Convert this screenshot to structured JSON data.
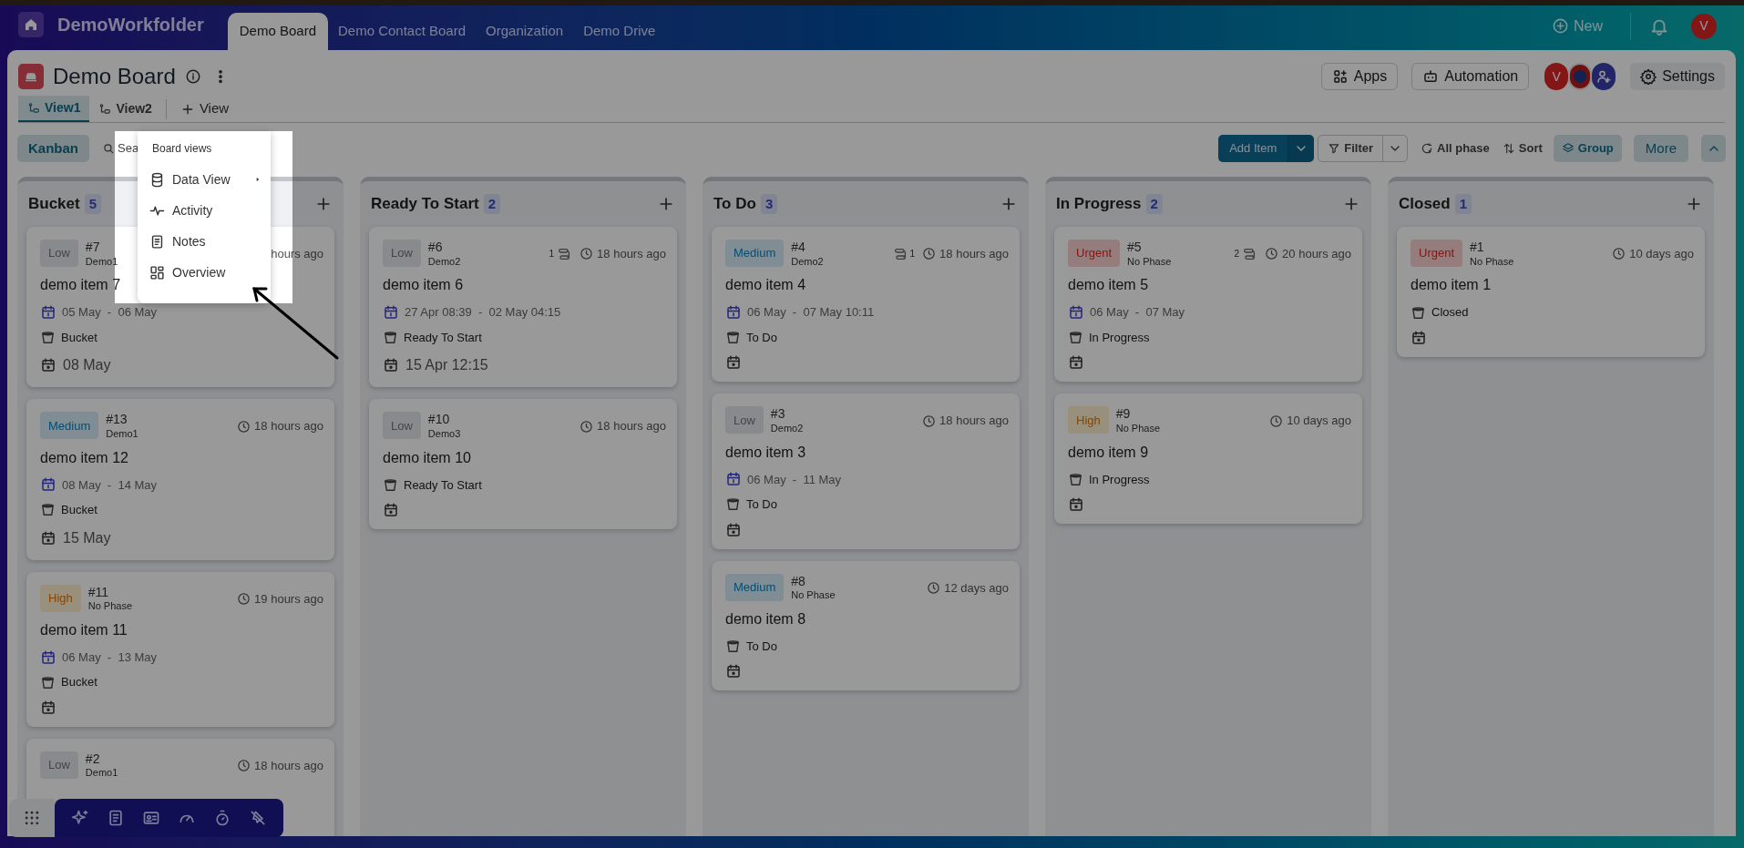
{
  "app": {
    "name": "DemoWorkfolder"
  },
  "nav_tabs": [
    {
      "label": "Demo Board",
      "selected": true
    },
    {
      "label": "Demo Contact Board",
      "selected": false
    },
    {
      "label": "Organization",
      "selected": false
    },
    {
      "label": "Demo Drive",
      "selected": false
    }
  ],
  "header_actions": {
    "new_label": "New",
    "avatar": "V"
  },
  "board": {
    "title": "Demo Board",
    "apps": "Apps",
    "automation": "Automation",
    "members": [
      {
        "kind": "letter",
        "initial": "V"
      },
      {
        "kind": "image"
      },
      {
        "kind": "add"
      }
    ],
    "settings": "Settings"
  },
  "views": [
    {
      "label": "View1",
      "selected": true
    },
    {
      "label": "View2",
      "selected": false
    }
  ],
  "add_view": "View",
  "toolbar": {
    "layout": "Kanban",
    "search": "Sea",
    "add_item": "Add Item",
    "filter": "Filter",
    "phase": "All phase",
    "sort": "Sort",
    "group": "Group",
    "more": "More"
  },
  "columns": [
    {
      "title": "Bucket",
      "count": "5",
      "cards": [
        {
          "priority": "Low",
          "kind": "low",
          "number": "#7",
          "group": "Demo1",
          "time": "hours ago",
          "title": "demo item 7",
          "dates": "05 May  -  06 May",
          "phase": "Bucket",
          "due": "08 May"
        },
        {
          "priority": "Medium",
          "kind": "medium",
          "number": "#13",
          "group": "Demo1",
          "time": "18 hours ago",
          "title": "demo item 12",
          "dates": "08 May  -  14 May",
          "phase": "Bucket",
          "due": "15 May"
        },
        {
          "priority": "High",
          "kind": "high",
          "number": "#11",
          "group": "No Phase",
          "time": "19 hours ago",
          "title": "demo item 11",
          "dates": "06 May  -  13 May",
          "phase": "Bucket"
        },
        {
          "priority": "Low",
          "kind": "low",
          "number": "#2",
          "group": "Demo1",
          "time": "18 hours ago"
        }
      ]
    },
    {
      "title": "Ready To Start",
      "count": "2",
      "cards": [
        {
          "priority": "Low",
          "kind": "low",
          "number": "#6",
          "group": "Demo2",
          "subitems": {
            "count": "1",
            "kind": "count_first"
          },
          "time": "18 hours ago",
          "title": "demo item 6",
          "dates": "27 Apr 08:39  -  02 May 04:15",
          "phase": "Ready To Start",
          "due": "15 Apr 12:15"
        },
        {
          "priority": "Low",
          "kind": "low",
          "number": "#10",
          "group": "Demo3",
          "time": "18 hours ago",
          "title": "demo item 10",
          "phase": "Ready To Start"
        }
      ]
    },
    {
      "title": "To Do",
      "count": "3",
      "cards": [
        {
          "priority": "Medium",
          "kind": "medium",
          "number": "#4",
          "group": "Demo2",
          "subitems": {
            "count": "1",
            "kind": "icon_first"
          },
          "time": "18 hours ago",
          "title": "demo item 4",
          "dates": "06 May  -  07 May 10:11",
          "phase": "To Do"
        },
        {
          "priority": "Low",
          "kind": "low",
          "number": "#3",
          "group": "Demo2",
          "time": "18 hours ago",
          "title": "demo item 3",
          "dates": "06 May  -  11 May",
          "phase": "To Do"
        },
        {
          "priority": "Medium",
          "kind": "medium",
          "number": "#8",
          "group": "No Phase",
          "time": "12 days ago",
          "title": "demo item 8",
          "phase": "To Do"
        }
      ]
    },
    {
      "title": "In Progress",
      "count": "2",
      "cards": [
        {
          "priority": "Urgent",
          "kind": "urgent",
          "number": "#5",
          "group": "No Phase",
          "subitems": {
            "count": "2",
            "kind": "count_first"
          },
          "time": "20 hours ago",
          "title": "demo item 5",
          "dates": "06 May  -  07 May",
          "phase": "In Progress"
        },
        {
          "priority": "High",
          "kind": "high",
          "number": "#9",
          "group": "No Phase",
          "time": "10 days ago",
          "title": "demo item 9",
          "phase": "In Progress"
        }
      ]
    },
    {
      "title": "Closed",
      "count": "1",
      "cards": [
        {
          "priority": "Urgent",
          "kind": "urgent",
          "number": "#1",
          "group": "No Phase",
          "time": "10 days ago",
          "title": "demo item 1",
          "phase": "Closed"
        }
      ]
    }
  ],
  "menu": {
    "title": "Board views",
    "items": [
      {
        "label": "Data View",
        "kind": "database",
        "submenu": true
      },
      {
        "label": "Activity",
        "kind": "activity",
        "submenu": false
      },
      {
        "label": "Notes",
        "kind": "notes",
        "submenu": false
      },
      {
        "label": "Overview",
        "kind": "overview",
        "submenu": false
      }
    ]
  }
}
